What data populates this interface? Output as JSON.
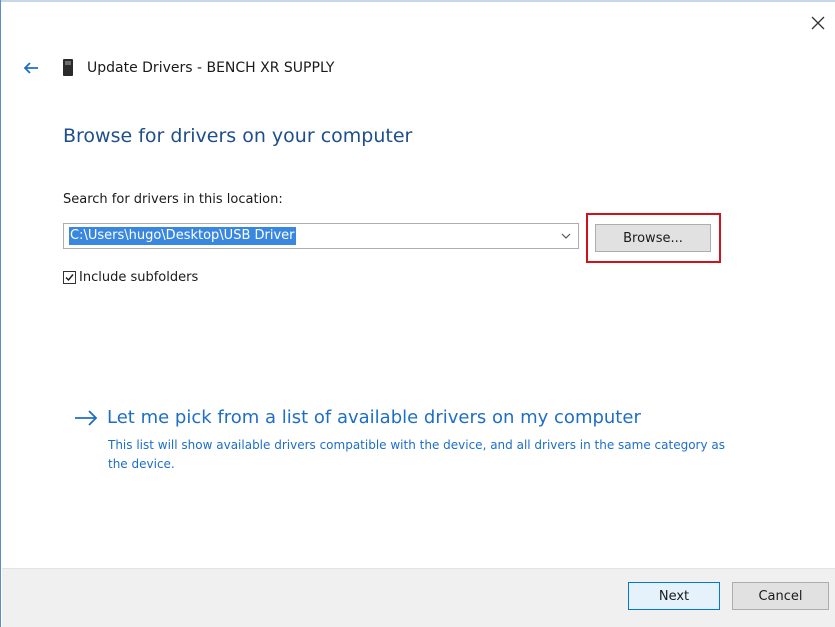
{
  "window": {
    "title": "Update Drivers - BENCH XR SUPPLY",
    "close_icon": "close-icon",
    "back_icon": "back-arrow-icon",
    "device_icon": "usb-device-icon"
  },
  "main": {
    "heading": "Browse for drivers on your computer",
    "search_label": "Search for drivers in this location:",
    "path_value": "C:\\Users\\hugo\\Desktop\\USB Driver",
    "browse_label": "Browse...",
    "include_subfolders_label": "Include subfolders",
    "include_subfolders_checked": true
  },
  "pick": {
    "title": "Let me pick from a list of available drivers on my computer",
    "description": "This list will show available drivers compatible with the device, and all drivers in the same category as the device."
  },
  "footer": {
    "next_label": "Next",
    "cancel_label": "Cancel"
  },
  "colors": {
    "heading": "#1e4e8c",
    "link": "#1e6ec8",
    "selection": "#3a87e0",
    "highlight_box": "#d0121b"
  }
}
